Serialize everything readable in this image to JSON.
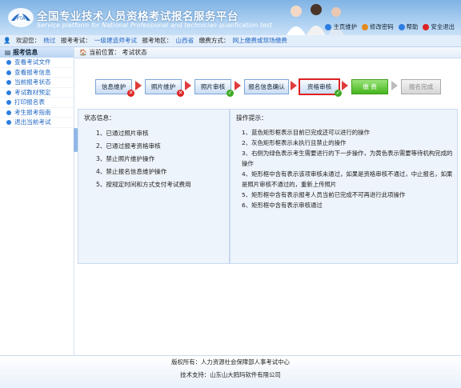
{
  "header": {
    "title_cn": "全国专业技术人员资格考试报名服务平台",
    "title_en": "Service platform for National Professional and technician qualification test",
    "actions": [
      "主页维护",
      "修改密码",
      "帮助",
      "安全退出"
    ],
    "action_colors": [
      "#2d7de0",
      "#e38b1c",
      "#2d7de0",
      "#d22"
    ]
  },
  "infobar": {
    "welcome_label": "欢迎您：",
    "welcome_value": "杨过",
    "exam_label": "报考考试：",
    "exam_value": "一级建造师考试",
    "region_label": "报考地区：",
    "region_value": "山西省",
    "pay_label": "缴费方式：",
    "pay_value": "网上缴费或现场缴费"
  },
  "sidebar": {
    "header": "报考信息",
    "items": [
      "查看考试文件",
      "查看报考信息",
      "当前报考状态",
      "考试教材预定",
      "打印报名表",
      "考生报考指南",
      "退出当前考试"
    ]
  },
  "breadcrumb": {
    "label": "当前位置：",
    "value": "考试状态"
  },
  "steps": [
    {
      "label": "信息维护",
      "style": "normal",
      "mark": "no"
    },
    {
      "label": "照片维护",
      "style": "normal",
      "mark": "no"
    },
    {
      "label": "照片审核",
      "style": "normal",
      "mark": "ok"
    },
    {
      "label": "报名信息确认",
      "style": "normal",
      "mark": ""
    },
    {
      "label": "资格审核",
      "style": "current",
      "mark": "ok"
    },
    {
      "label": "缴 费",
      "style": "green",
      "mark": ""
    },
    {
      "label": "报名完成",
      "style": "gray",
      "mark": ""
    }
  ],
  "status": {
    "title": "状态信息：",
    "items": [
      "1、已通过照片审核",
      "2、已通过报考资格审核",
      "3、禁止照片维护操作",
      "4、禁止报名信息维护操作",
      "5、按规定时间和方式支付考试费用"
    ]
  },
  "tips": {
    "title": "操作提示：",
    "items": [
      "1、蓝色矩形框表示目前已完成还可以进行的操作",
      "2、灰色矩形框表示未执行且禁止的操作",
      "3、右侧为绿色表示考生需要进行的下一步操作，为黄色表示需要等待机构完成的操作",
      "4、矩形框中含有表示该项审核未通过，如果是资格审核不通过，中止报名，如果是照片审核不通过的，重新上传照片",
      "5、矩形框中含有表示报考人员当前已完成不可再进行此项操作",
      "6、矩形框中含有表示审核通过"
    ]
  },
  "footer": {
    "line1": "版权所有：人力资源社会保障部人事考试中心",
    "line2": "技术支持：山东山大鸥玛软件有限公司"
  }
}
